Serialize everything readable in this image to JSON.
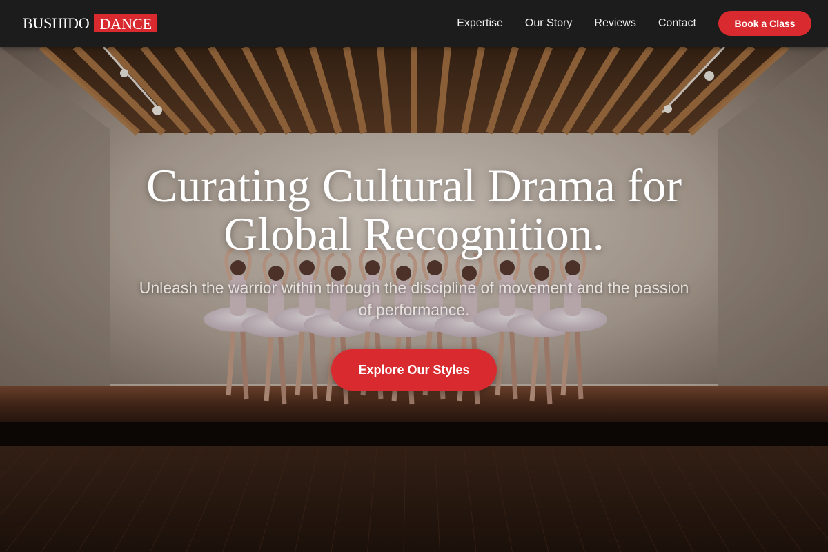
{
  "brand": {
    "name": "BUSHIDO",
    "accent_word": "DANCE",
    "accent_color": "#d92b2f"
  },
  "nav": {
    "items": [
      {
        "label": "Expertise"
      },
      {
        "label": "Our Story"
      },
      {
        "label": "Reviews"
      },
      {
        "label": "Contact"
      }
    ],
    "cta_label": "Book a Class"
  },
  "hero": {
    "title_line1": "Curating Cultural Drama for",
    "title_line2": "Global Recognition.",
    "subtitle": "Unleash the warrior within through the discipline of movement and the passion of performance.",
    "button_label": "Explore Our Styles",
    "background_scene": "ballet-studio-photo"
  }
}
